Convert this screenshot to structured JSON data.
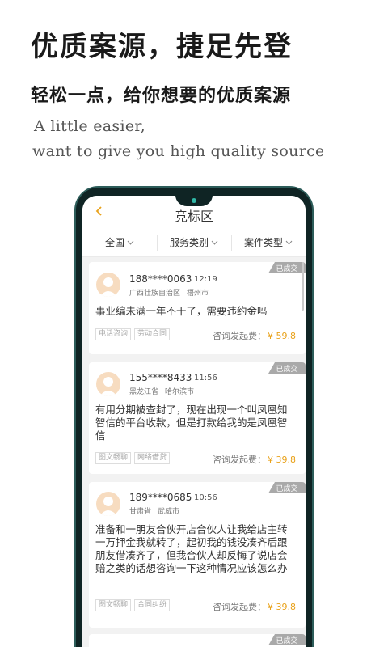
{
  "promo": {
    "title": "优质案源，捷足先登",
    "subtitle": "轻松一点，给你想要的优质案源",
    "english_line1": "A little easier,",
    "english_line2": "want to give you high quality source"
  },
  "app": {
    "title": "竞标区",
    "back_icon": "chevron-left-icon",
    "accent_color": "#e9a21b"
  },
  "filters": [
    {
      "label": "全国"
    },
    {
      "label": "服务类别"
    },
    {
      "label": "案件类型"
    }
  ],
  "fee_label": "咨询发起费：",
  "cards": [
    {
      "status": "已成交",
      "phone": "188****0063",
      "time": "12:19",
      "province": "广西壮族自治区",
      "city": "梧州市",
      "question": "事业编未满一年不干了，需要违约金吗",
      "tags": [
        "电话咨询",
        "劳动合同"
      ],
      "fee": "¥ 59.8"
    },
    {
      "status": "已成交",
      "phone": "155****8433",
      "time": "11:56",
      "province": "黑龙江省",
      "city": "哈尔滨市",
      "question": "有用分期被查封了，现在出现一个叫凤凰知智信的平台收款，但是打款给我的是凤凰智信",
      "tags": [
        "图文畅聊",
        "网络借贷"
      ],
      "fee": "¥ 39.8"
    },
    {
      "status": "已成交",
      "phone": "189****0685",
      "time": "10:56",
      "province": "甘肃省",
      "city": "武威市",
      "question": "准备和一朋友合伙开店合伙人让我给店主转一万押金我就转了，起初我的钱没凑齐后跟朋友借凑齐了，但我合伙人却反悔了说店会赔之类的话想咨询一下这种情况应该怎么办",
      "tags": [
        "图文畅聊",
        "合同纠纷"
      ],
      "fee": "¥ 39.8"
    },
    {
      "status": "已成交"
    }
  ]
}
